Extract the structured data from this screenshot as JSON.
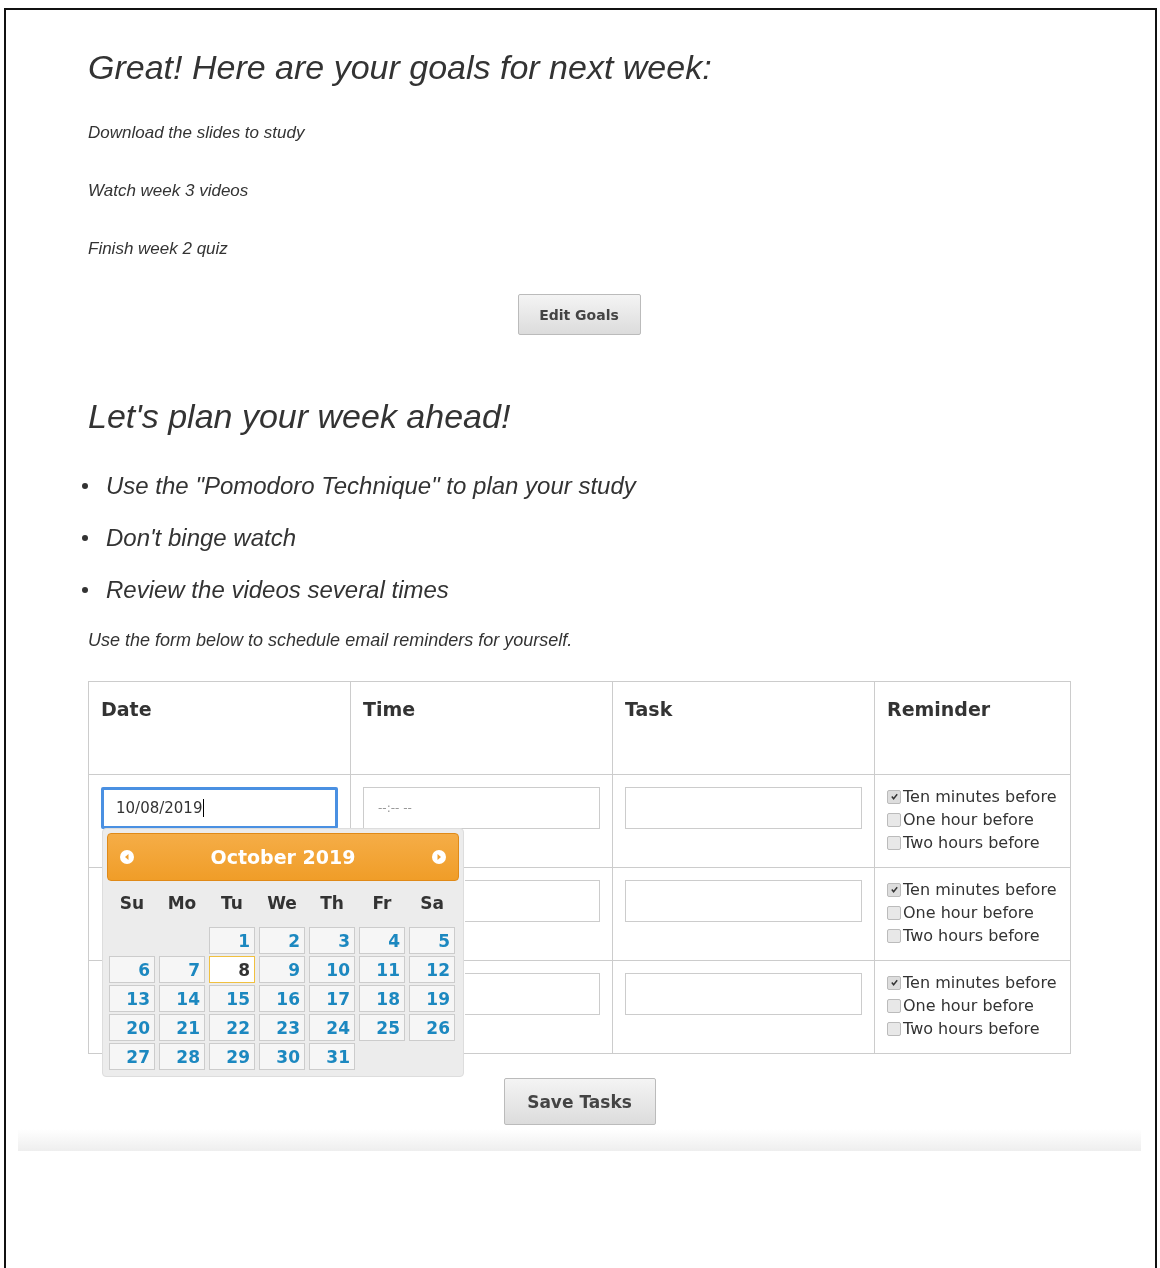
{
  "goals_heading": "Great! Here are your goals for next week:",
  "goals": [
    "Download the slides to study",
    "Watch week 3 videos",
    "Finish week 2 quiz"
  ],
  "edit_button": "Edit Goals",
  "plan_heading": "Let's plan your week ahead!",
  "tips": [
    "Use the \"Pomodoro Technique\" to plan your study",
    "Don't binge watch",
    "Review the videos several times"
  ],
  "form_note": "Use the form below to schedule email reminders for yourself.",
  "table": {
    "columns": [
      "Date",
      "Time",
      "Task",
      "Reminder"
    ],
    "rows": [
      {
        "date": "10/08/2019",
        "time_placeholder": "--:-- --",
        "reminders": [
          {
            "label": "Ten minutes before",
            "checked": true
          },
          {
            "label": "One hour before",
            "checked": false
          },
          {
            "label": "Two hours before",
            "checked": false
          }
        ]
      },
      {
        "reminders": [
          {
            "label": "Ten minutes before",
            "checked": true
          },
          {
            "label": "One hour before",
            "checked": false
          },
          {
            "label": "Two hours before",
            "checked": false
          }
        ]
      },
      {
        "reminders": [
          {
            "label": "Ten minutes before",
            "checked": true
          },
          {
            "label": "One hour before",
            "checked": false
          },
          {
            "label": "Two hours before",
            "checked": false
          }
        ]
      }
    ]
  },
  "datepicker": {
    "title": "October 2019",
    "weekdays": [
      "Su",
      "Mo",
      "Tu",
      "We",
      "Th",
      "Fr",
      "Sa"
    ],
    "days": [
      {
        "label": "1",
        "selected": false
      },
      {
        "label": "2",
        "selected": false
      },
      {
        "label": "3",
        "selected": false
      },
      {
        "label": "4",
        "selected": false
      },
      {
        "label": "5",
        "selected": false
      },
      {
        "label": "6",
        "selected": false
      },
      {
        "label": "7",
        "selected": false
      },
      {
        "label": "8",
        "selected": true
      },
      {
        "label": "9",
        "selected": false
      },
      {
        "label": "10",
        "selected": false
      },
      {
        "label": "11",
        "selected": false
      },
      {
        "label": "12",
        "selected": false
      },
      {
        "label": "13",
        "selected": false
      },
      {
        "label": "14",
        "selected": false
      },
      {
        "label": "15",
        "selected": false
      },
      {
        "label": "16",
        "selected": false
      },
      {
        "label": "17",
        "selected": false
      },
      {
        "label": "18",
        "selected": false
      },
      {
        "label": "19",
        "selected": false
      },
      {
        "label": "20",
        "selected": false
      },
      {
        "label": "21",
        "selected": false
      },
      {
        "label": "22",
        "selected": false
      },
      {
        "label": "23",
        "selected": false
      },
      {
        "label": "24",
        "selected": false
      },
      {
        "label": "25",
        "selected": false
      },
      {
        "label": "26",
        "selected": false
      },
      {
        "label": "27",
        "selected": false
      },
      {
        "label": "28",
        "selected": false
      },
      {
        "label": "29",
        "selected": false
      },
      {
        "label": "30",
        "selected": false
      },
      {
        "label": "31",
        "selected": false
      }
    ]
  },
  "save_button": "Save Tasks"
}
